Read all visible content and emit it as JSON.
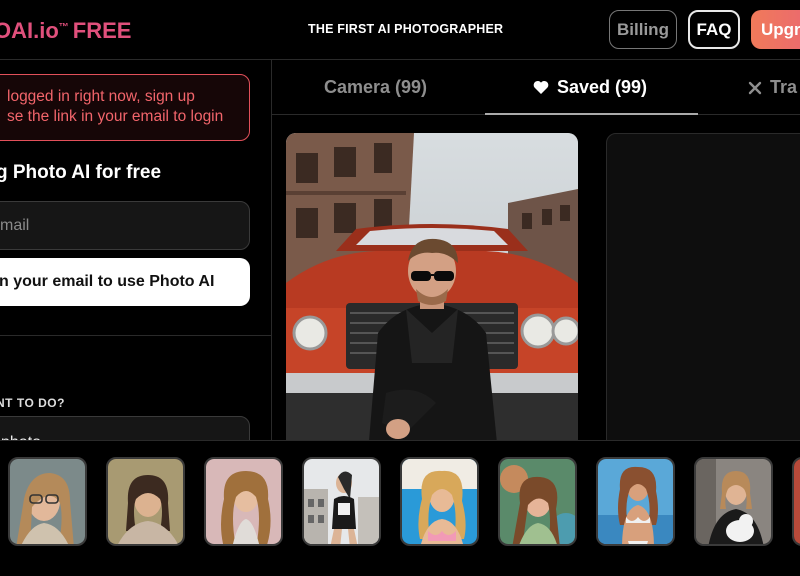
{
  "header": {
    "logo_text": "OAI.io",
    "logo_tm": "™",
    "logo_free": "FREE",
    "tagline": "THE FIRST AI PHOTOGRAPHER",
    "billing_label": "Billing",
    "faq_label": "FAQ",
    "upgrade_label": "Upgrade"
  },
  "sidebar": {
    "alert_line1": "logged in right now, sign up",
    "alert_line2": "se the link in your email to login",
    "signup_title": "g Photo AI for free",
    "email_placeholder": "mail",
    "signin_label": "n your email to use Photo AI",
    "question": "NT TO DO?",
    "select_value": "photo"
  },
  "tabs": [
    {
      "label": "Camera (99)",
      "icon": "camera-icon",
      "active": false
    },
    {
      "label": "Saved (99)",
      "icon": "heart-icon",
      "active": true
    },
    {
      "label": "Tra",
      "icon": "close-icon",
      "active": false
    }
  ],
  "colors": {
    "brand_pink": "#e0507c",
    "alert_red": "#e2505a",
    "upgrade_gradient_start": "#f07a5a",
    "upgrade_gradient_end": "#e8607a"
  },
  "thumbnails": [
    {
      "icon": "woman-glasses-thumbnail"
    },
    {
      "icon": "woman-outdoor-thumbnail"
    },
    {
      "icon": "woman-curly-hair-thumbnail"
    },
    {
      "icon": "woman-building-thumbnail"
    },
    {
      "icon": "woman-pool-thumbnail"
    },
    {
      "icon": "woman-colorful-thumbnail"
    },
    {
      "icon": "woman-beach-thumbnail"
    },
    {
      "icon": "woman-cat-thumbnail"
    },
    {
      "icon": "partial-thumbnail"
    }
  ]
}
